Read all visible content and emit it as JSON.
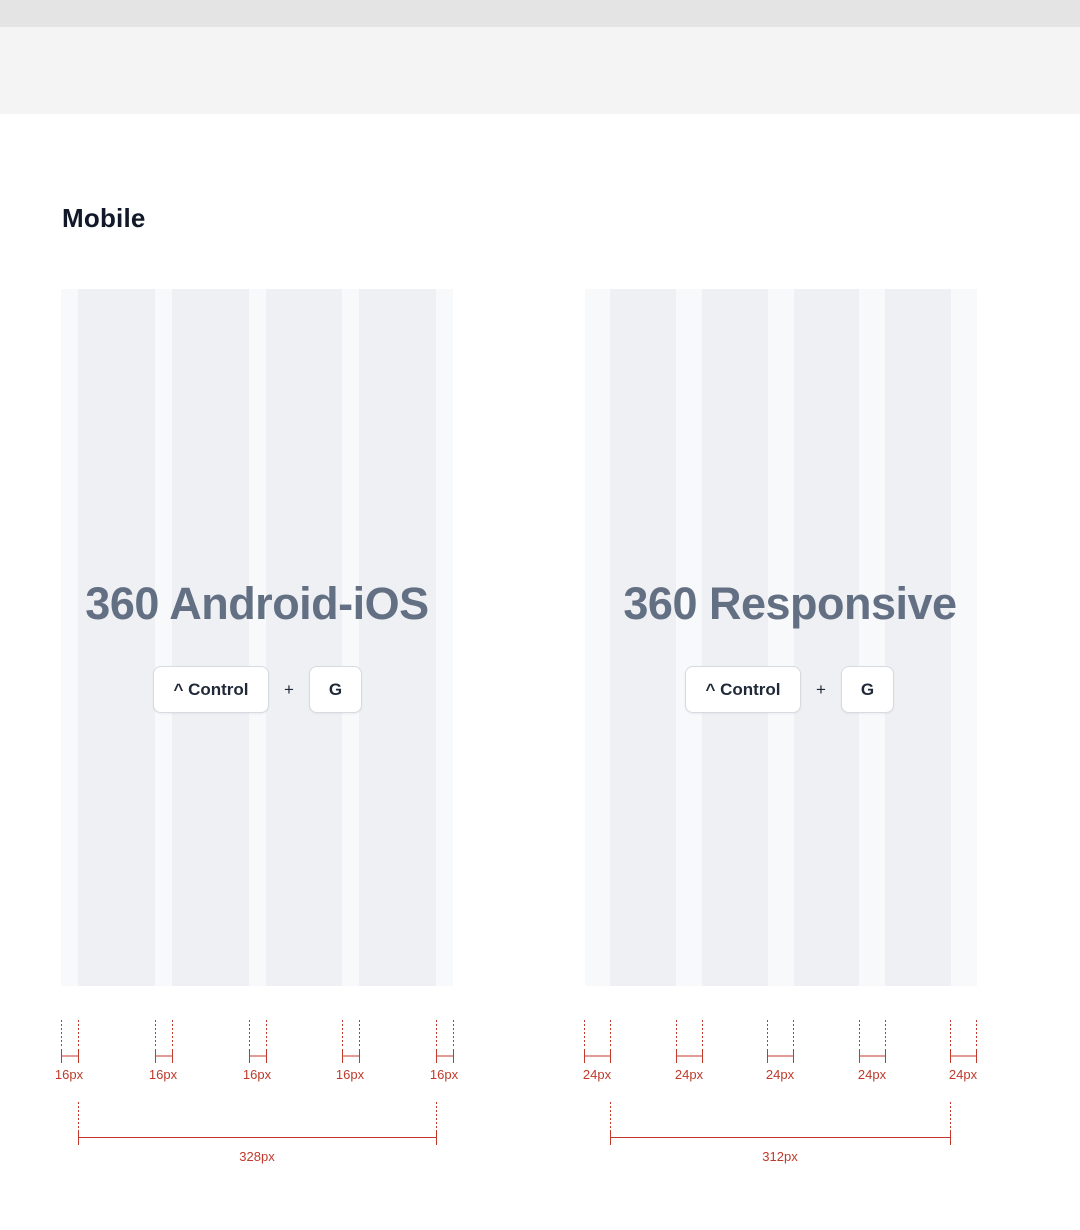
{
  "section_title": "Mobile",
  "colors": {
    "measure": "#c0392b"
  },
  "grids": [
    {
      "title": "360 Android-iOS",
      "shortcut": {
        "modifier": "^ Control",
        "plus": "+",
        "key": "G"
      },
      "margin_label": "16px",
      "gutter_labels": [
        "16px",
        "16px",
        "16px",
        "16px",
        "16px"
      ],
      "content_width_label": "328px"
    },
    {
      "title": "360 Responsive",
      "shortcut": {
        "modifier": "^ Control",
        "plus": "+",
        "key": "G"
      },
      "margin_label": "24px",
      "gutter_labels": [
        "24px",
        "24px",
        "24px",
        "24px",
        "24px"
      ],
      "content_width_label": "312px"
    }
  ]
}
